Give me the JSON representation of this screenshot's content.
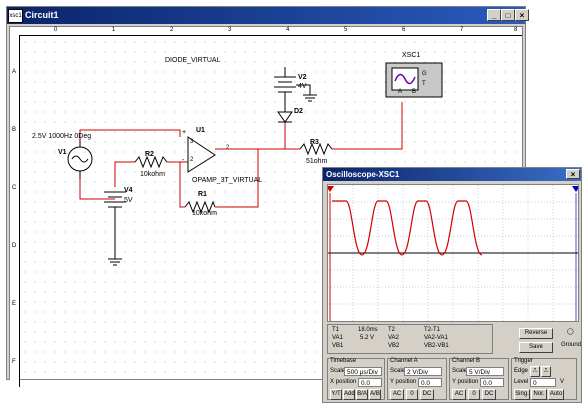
{
  "window": {
    "title": "Circuit1",
    "icon_text": "xsc1",
    "minimize": "_",
    "maximize": "□",
    "close": "×"
  },
  "ruler": {
    "cols": [
      "0",
      "1",
      "2",
      "3",
      "4",
      "5",
      "6",
      "7",
      "8"
    ],
    "rows": [
      "A",
      "B",
      "C",
      "D",
      "E",
      "F"
    ]
  },
  "schematic": {
    "diode_title": "DIODE_VIRTUAL",
    "v1_label": "V1",
    "v1_value": "2.5V 1000Hz 0Deg",
    "u1_label": "U1",
    "u1_model": "OPAMP_3T_VIRTUAL",
    "r2_label": "R2",
    "r2_value": "10kohm",
    "r1_label": "R1",
    "r1_value": "10kohm",
    "v4_label": "V4",
    "v4_value": "5V",
    "v2_label": "V2",
    "v2_value": "4V",
    "d2_label": "D2",
    "r3_label": "R3",
    "r3_value": "51ohm",
    "xsc_label": "XSC1",
    "xsc_g": "G",
    "xsc_t": "T",
    "xsc_a": "A",
    "xsc_b": "B",
    "pin_plus": "+",
    "pin_minus": "-",
    "pin3": "3",
    "pin2": "2",
    "pin_out": "2"
  },
  "scope": {
    "title": "Oscilloscope-XSC1",
    "close": "×",
    "t1_label": "T1",
    "t1_time": "18.0ms",
    "t1_va1": "5.2 V",
    "t1_vb1": "",
    "t2_label": "T2",
    "t2_va2": "",
    "t2_vb2": "",
    "diff_label": "T2-T1",
    "va1": "VA1",
    "vb1": "VB1",
    "va2": "VA2",
    "vb2": "VB2",
    "va2_va1": "VA2-VA1",
    "vb2_vb1": "VB2-VB1",
    "reverse": "Reverse",
    "save": "Save",
    "ground": "Ground",
    "timebase": {
      "header": "Timebase",
      "scale_label": "Scale",
      "scale": "500 μs/Div",
      "xpos_label": "X position",
      "xpos": "0.0",
      "btns": [
        "Y/T",
        "Add",
        "B/A",
        "A/B"
      ]
    },
    "channel_a": {
      "header": "Channel A",
      "scale_label": "Scale",
      "scale": "2 V/Div",
      "ypos_label": "Y position",
      "ypos": "0.0",
      "btns": [
        "AC",
        "0",
        "DC"
      ]
    },
    "channel_b": {
      "header": "Channel B",
      "scale_label": "Scale",
      "scale": "5 V/Div",
      "ypos_label": "Y position",
      "ypos": "0.0",
      "btns": [
        "AC",
        "0",
        "DC"
      ]
    },
    "trigger": {
      "header": "Trigger",
      "edge_label": "Edge",
      "level_label": "Level",
      "level": "0",
      "unit": "V",
      "btns": [
        "Sing.",
        "Nor.",
        "Auto"
      ]
    }
  }
}
